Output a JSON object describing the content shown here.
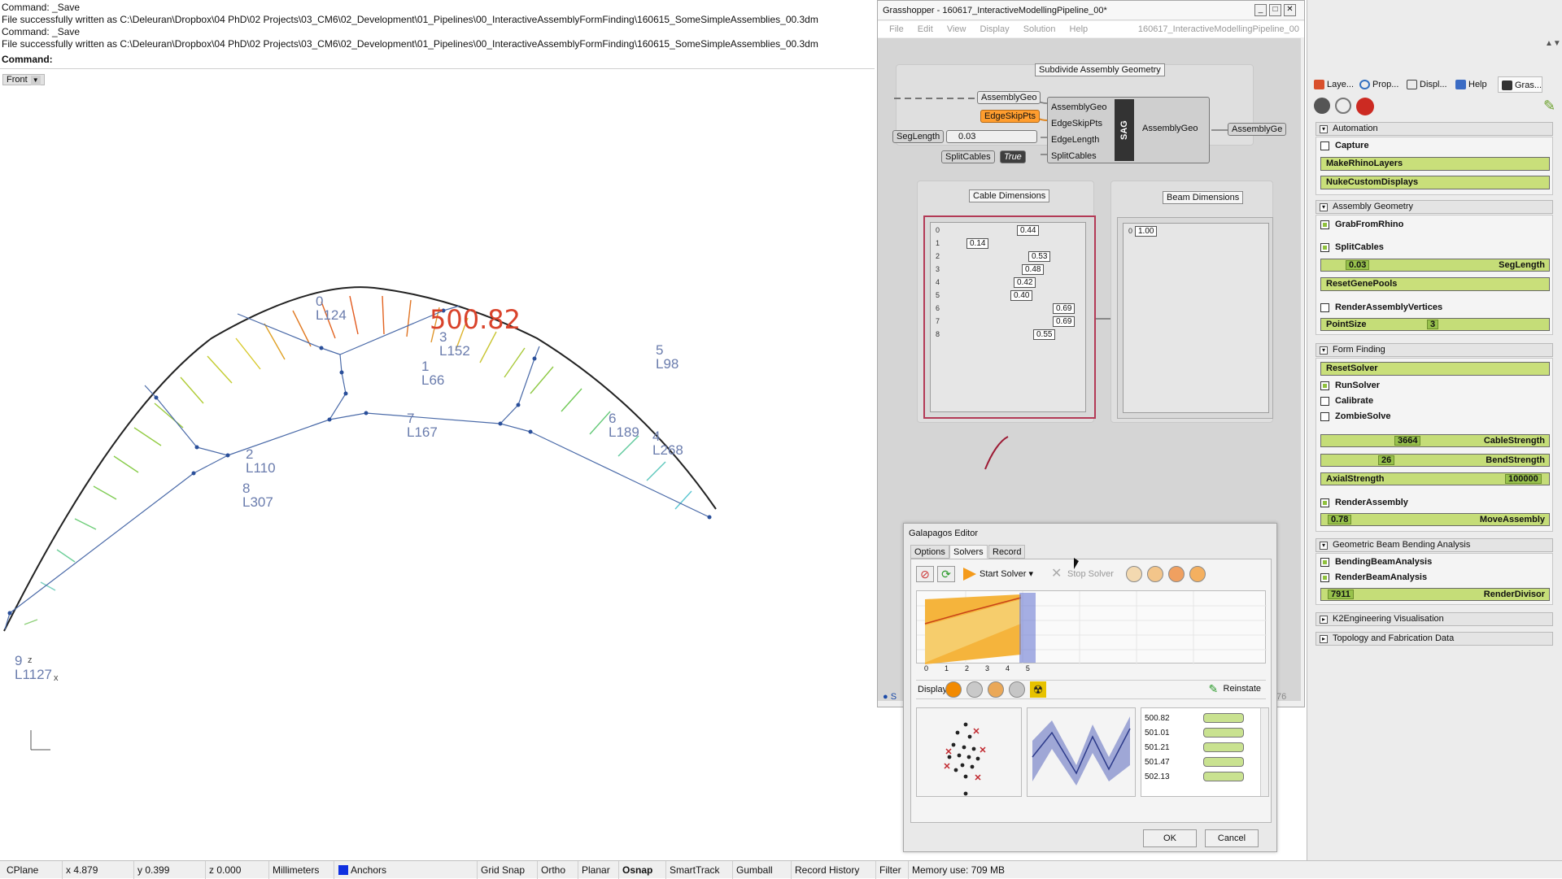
{
  "command_history": [
    "Command: _Save",
    "File successfully written as C:\\Deleuran\\Dropbox\\04 PhD\\02 Projects\\03_CM6\\02_Development\\01_Pipelines\\00_InteractiveAssemblyFormFinding\\160615_SomeSimpleAssemblies_00.3dm",
    "Command: _Save",
    "File successfully written as C:\\Deleuran\\Dropbox\\04 PhD\\02 Projects\\03_CM6\\02_Development\\01_Pipelines\\00_InteractiveAssemblyFormFinding\\160615_SomeSimpleAssemblies_00.3dm"
  ],
  "command_prompt": "Command:",
  "viewport": {
    "name": "Front",
    "fitness_value": "500.82",
    "axis_x": "x",
    "axis_z": "z",
    "node_labels": [
      {
        "id": "0",
        "len": "L124"
      },
      {
        "id": "3",
        "len": "L152"
      },
      {
        "id": "1",
        "len": "L66"
      },
      {
        "id": "7",
        "len": "L167"
      },
      {
        "id": "2",
        "len": "L110"
      },
      {
        "id": "8",
        "len": "L307"
      },
      {
        "id": "5",
        "len": "L98"
      },
      {
        "id": "6",
        "len": "L189"
      },
      {
        "id": "4",
        "len": "L268"
      },
      {
        "id": "9",
        "len": "L1127"
      }
    ]
  },
  "grasshopper": {
    "title": "Grasshopper - 160617_InteractiveModellingPipeline_00*",
    "menu": [
      "File",
      "Edit",
      "View",
      "Display",
      "Solution",
      "Help"
    ],
    "doc_name": "160617_InteractiveModellingPipeline_00",
    "group_subdivide": "Subdivide Assembly Geometry",
    "chips": {
      "assembly_geo": "AssemblyGeo",
      "edge_skip_pts": "EdgeSkipPts",
      "seg_length": "SegLength",
      "seg_length_value": "0.03",
      "split_cables": "SplitCables",
      "split_cables_value": "True"
    },
    "sag_component": {
      "inputs": [
        "AssemblyGeo",
        "EdgeSkipPts",
        "EdgeLength",
        "SplitCables"
      ],
      "name": "SAG",
      "output": "AssemblyGeo",
      "output_chip": "AssemblyGe"
    },
    "cable_dimensions": {
      "label": "Cable Dimensions",
      "rows": [
        "0",
        "1",
        "2",
        "3",
        "4",
        "5",
        "6",
        "7",
        "8"
      ],
      "values": [
        "0.44",
        "0.14",
        "0.53",
        "0.48",
        "0.42",
        "0.40",
        "0.69",
        "0.69",
        "0.55"
      ]
    },
    "beam_dimensions": {
      "label": "Beam Dimensions",
      "rows": [
        "0"
      ],
      "values": [
        "1.00"
      ]
    },
    "status_stub": "76"
  },
  "galapagos": {
    "title": "Galapagos Editor",
    "tabs": [
      "Options",
      "Solvers",
      "Record"
    ],
    "active_tab": "Solvers",
    "start_solver": "Start Solver",
    "stop_solver": "Stop Solver",
    "graph_x_ticks": [
      "0",
      "1",
      "2",
      "3",
      "4",
      "5"
    ],
    "display_label": "Display",
    "reinstate": "Reinstate",
    "genomes": [
      "500.82",
      "501.01",
      "501.21",
      "501.47",
      "502.13"
    ],
    "ok": "OK",
    "cancel": "Cancel"
  },
  "right_panel": {
    "tabs": [
      "Laye...",
      "Prop...",
      "Displ...",
      "Help",
      "Gras..."
    ],
    "sections": {
      "automation": {
        "title": "Automation",
        "capture": "Capture",
        "make_rhino_layers": "MakeRhinoLayers",
        "nuke_custom_displays": "NukeCustomDisplays"
      },
      "assembly_geometry": {
        "title": "Assembly Geometry",
        "grab_from_rhino": "GrabFromRhino",
        "split_cables": "SplitCables",
        "seg_length_value": "0.03",
        "seg_length": "SegLength",
        "reset_gene_pools": "ResetGenePools",
        "render_assembly_vertices": "RenderAssemblyVertices",
        "point_size": "PointSize",
        "point_size_value": "3"
      },
      "form_finding": {
        "title": "Form Finding",
        "reset_solver": "ResetSolver",
        "run_solver": "RunSolver",
        "calibrate": "Calibrate",
        "zombie_solve": "ZombieSolve",
        "cable_strength_value": "3664",
        "cable_strength": "CableStrength",
        "bend_strength_value": "26",
        "bend_strength": "BendStrength",
        "axial_strength": "AxialStrength",
        "axial_strength_value": "100000",
        "render_assembly": "RenderAssembly",
        "move_assembly_value": "0.78",
        "move_assembly": "MoveAssembly"
      },
      "beam_bending": {
        "title": "Geometric Beam Bending Analysis",
        "bending_beam_analysis": "BendingBeamAnalysis",
        "render_beam_analysis": "RenderBeamAnalysis",
        "render_divisor_value": "7911",
        "render_divisor": "RenderDivisor"
      },
      "k2": {
        "title": "K2Engineering Visualisation"
      },
      "topology": {
        "title": "Topology and Fabrication Data"
      }
    }
  },
  "status_bar": {
    "cplane": "CPlane",
    "x": "x 4.879",
    "y": "y 0.399",
    "z": "z 0.000",
    "units": "Millimeters",
    "layer": "Anchors",
    "layer_color": "#1030e0",
    "grid_snap": "Grid Snap",
    "ortho": "Ortho",
    "planar": "Planar",
    "osnap": "Osnap",
    "smarttrack": "SmartTrack",
    "gumball": "Gumball",
    "record_history": "Record History",
    "filter": "Filter",
    "memory": "Memory use: 709 MB"
  },
  "colors": {
    "accent_green": "#c5dd78",
    "highlight_orange": "#ff9d2e",
    "fitness_red": "#d9432b",
    "struct_blue": "#4a6aa8"
  }
}
